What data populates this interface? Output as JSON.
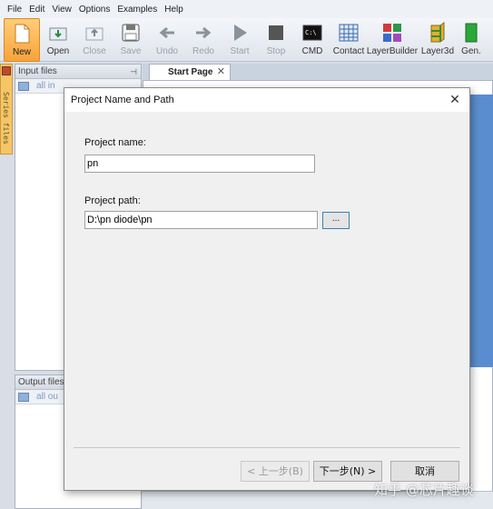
{
  "menu": [
    "File",
    "Edit",
    "View",
    "Options",
    "Examples",
    "Help"
  ],
  "toolbar": [
    {
      "label": "New",
      "icon": "new-file-icon",
      "state": "active"
    },
    {
      "label": "Open",
      "icon": "open-icon",
      "state": "normal"
    },
    {
      "label": "Close",
      "icon": "close-project-icon",
      "state": "disabled"
    },
    {
      "label": "Save",
      "icon": "save-icon",
      "state": "disabled"
    },
    {
      "label": "Undo",
      "icon": "undo-arrow-icon",
      "state": "disabled"
    },
    {
      "label": "Redo",
      "icon": "redo-arrow-icon",
      "state": "disabled"
    },
    {
      "label": "Start",
      "icon": "play-icon",
      "state": "disabled"
    },
    {
      "label": "Stop",
      "icon": "stop-icon",
      "state": "disabled"
    },
    {
      "label": "CMD",
      "icon": "terminal-icon",
      "state": "normal"
    },
    {
      "label": "Contact",
      "icon": "grid-icon",
      "state": "normal"
    },
    {
      "label": "LayerBuilder",
      "icon": "layer-blocks-icon",
      "state": "normal"
    },
    {
      "label": "Layer3d",
      "icon": "layer3d-icon",
      "state": "normal"
    },
    {
      "label": "Gen.",
      "icon": "generate-icon",
      "state": "normal"
    }
  ],
  "side_strip": {
    "label": "Series files"
  },
  "input_pane": {
    "title": "Input files",
    "toolbar_text": "all  in"
  },
  "output_pane": {
    "title": "Output files",
    "toolbar_text": "all  ou"
  },
  "tabs": [
    {
      "label": "Start Page"
    }
  ],
  "dialog": {
    "title": "Project Name and Path",
    "project_name_label": "Project name:",
    "project_name_value": "pn",
    "project_path_label": "Project path:",
    "project_path_value": "D:\\pn diode\\pn",
    "browse_label": "...",
    "back_label": "< 上一步(B)",
    "next_label": "下一步(N) >",
    "cancel_label": "取消"
  },
  "watermark": "知乎 @芯片趣谈",
  "colors": {
    "accent": "#f7a33a",
    "panel_blue": "#5a8dcf"
  }
}
